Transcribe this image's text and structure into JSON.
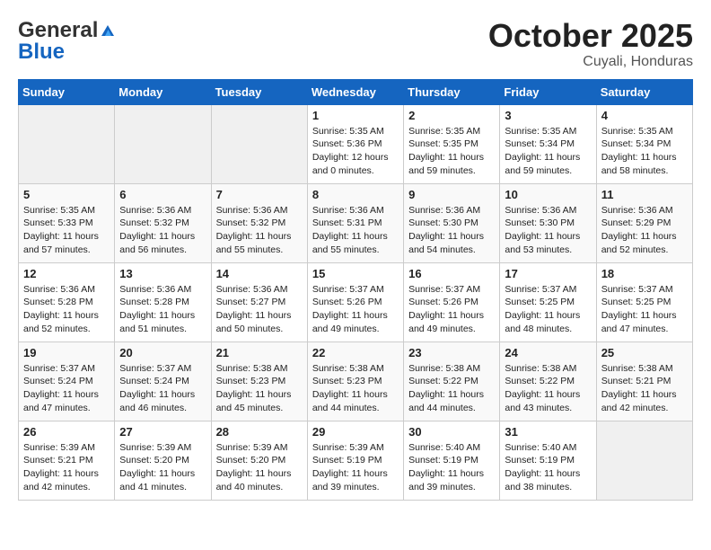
{
  "logo": {
    "general": "General",
    "blue": "Blue"
  },
  "title": "October 2025",
  "location": "Cuyali, Honduras",
  "days_of_week": [
    "Sunday",
    "Monday",
    "Tuesday",
    "Wednesday",
    "Thursday",
    "Friday",
    "Saturday"
  ],
  "weeks": [
    [
      {
        "day": "",
        "info": ""
      },
      {
        "day": "",
        "info": ""
      },
      {
        "day": "",
        "info": ""
      },
      {
        "day": "1",
        "info": "Sunrise: 5:35 AM\nSunset: 5:36 PM\nDaylight: 12 hours\nand 0 minutes."
      },
      {
        "day": "2",
        "info": "Sunrise: 5:35 AM\nSunset: 5:35 PM\nDaylight: 11 hours\nand 59 minutes."
      },
      {
        "day": "3",
        "info": "Sunrise: 5:35 AM\nSunset: 5:34 PM\nDaylight: 11 hours\nand 59 minutes."
      },
      {
        "day": "4",
        "info": "Sunrise: 5:35 AM\nSunset: 5:34 PM\nDaylight: 11 hours\nand 58 minutes."
      }
    ],
    [
      {
        "day": "5",
        "info": "Sunrise: 5:35 AM\nSunset: 5:33 PM\nDaylight: 11 hours\nand 57 minutes."
      },
      {
        "day": "6",
        "info": "Sunrise: 5:36 AM\nSunset: 5:32 PM\nDaylight: 11 hours\nand 56 minutes."
      },
      {
        "day": "7",
        "info": "Sunrise: 5:36 AM\nSunset: 5:32 PM\nDaylight: 11 hours\nand 55 minutes."
      },
      {
        "day": "8",
        "info": "Sunrise: 5:36 AM\nSunset: 5:31 PM\nDaylight: 11 hours\nand 55 minutes."
      },
      {
        "day": "9",
        "info": "Sunrise: 5:36 AM\nSunset: 5:30 PM\nDaylight: 11 hours\nand 54 minutes."
      },
      {
        "day": "10",
        "info": "Sunrise: 5:36 AM\nSunset: 5:30 PM\nDaylight: 11 hours\nand 53 minutes."
      },
      {
        "day": "11",
        "info": "Sunrise: 5:36 AM\nSunset: 5:29 PM\nDaylight: 11 hours\nand 52 minutes."
      }
    ],
    [
      {
        "day": "12",
        "info": "Sunrise: 5:36 AM\nSunset: 5:28 PM\nDaylight: 11 hours\nand 52 minutes."
      },
      {
        "day": "13",
        "info": "Sunrise: 5:36 AM\nSunset: 5:28 PM\nDaylight: 11 hours\nand 51 minutes."
      },
      {
        "day": "14",
        "info": "Sunrise: 5:36 AM\nSunset: 5:27 PM\nDaylight: 11 hours\nand 50 minutes."
      },
      {
        "day": "15",
        "info": "Sunrise: 5:37 AM\nSunset: 5:26 PM\nDaylight: 11 hours\nand 49 minutes."
      },
      {
        "day": "16",
        "info": "Sunrise: 5:37 AM\nSunset: 5:26 PM\nDaylight: 11 hours\nand 49 minutes."
      },
      {
        "day": "17",
        "info": "Sunrise: 5:37 AM\nSunset: 5:25 PM\nDaylight: 11 hours\nand 48 minutes."
      },
      {
        "day": "18",
        "info": "Sunrise: 5:37 AM\nSunset: 5:25 PM\nDaylight: 11 hours\nand 47 minutes."
      }
    ],
    [
      {
        "day": "19",
        "info": "Sunrise: 5:37 AM\nSunset: 5:24 PM\nDaylight: 11 hours\nand 47 minutes."
      },
      {
        "day": "20",
        "info": "Sunrise: 5:37 AM\nSunset: 5:24 PM\nDaylight: 11 hours\nand 46 minutes."
      },
      {
        "day": "21",
        "info": "Sunrise: 5:38 AM\nSunset: 5:23 PM\nDaylight: 11 hours\nand 45 minutes."
      },
      {
        "day": "22",
        "info": "Sunrise: 5:38 AM\nSunset: 5:23 PM\nDaylight: 11 hours\nand 44 minutes."
      },
      {
        "day": "23",
        "info": "Sunrise: 5:38 AM\nSunset: 5:22 PM\nDaylight: 11 hours\nand 44 minutes."
      },
      {
        "day": "24",
        "info": "Sunrise: 5:38 AM\nSunset: 5:22 PM\nDaylight: 11 hours\nand 43 minutes."
      },
      {
        "day": "25",
        "info": "Sunrise: 5:38 AM\nSunset: 5:21 PM\nDaylight: 11 hours\nand 42 minutes."
      }
    ],
    [
      {
        "day": "26",
        "info": "Sunrise: 5:39 AM\nSunset: 5:21 PM\nDaylight: 11 hours\nand 42 minutes."
      },
      {
        "day": "27",
        "info": "Sunrise: 5:39 AM\nSunset: 5:20 PM\nDaylight: 11 hours\nand 41 minutes."
      },
      {
        "day": "28",
        "info": "Sunrise: 5:39 AM\nSunset: 5:20 PM\nDaylight: 11 hours\nand 40 minutes."
      },
      {
        "day": "29",
        "info": "Sunrise: 5:39 AM\nSunset: 5:19 PM\nDaylight: 11 hours\nand 39 minutes."
      },
      {
        "day": "30",
        "info": "Sunrise: 5:40 AM\nSunset: 5:19 PM\nDaylight: 11 hours\nand 39 minutes."
      },
      {
        "day": "31",
        "info": "Sunrise: 5:40 AM\nSunset: 5:19 PM\nDaylight: 11 hours\nand 38 minutes."
      },
      {
        "day": "",
        "info": ""
      }
    ]
  ]
}
